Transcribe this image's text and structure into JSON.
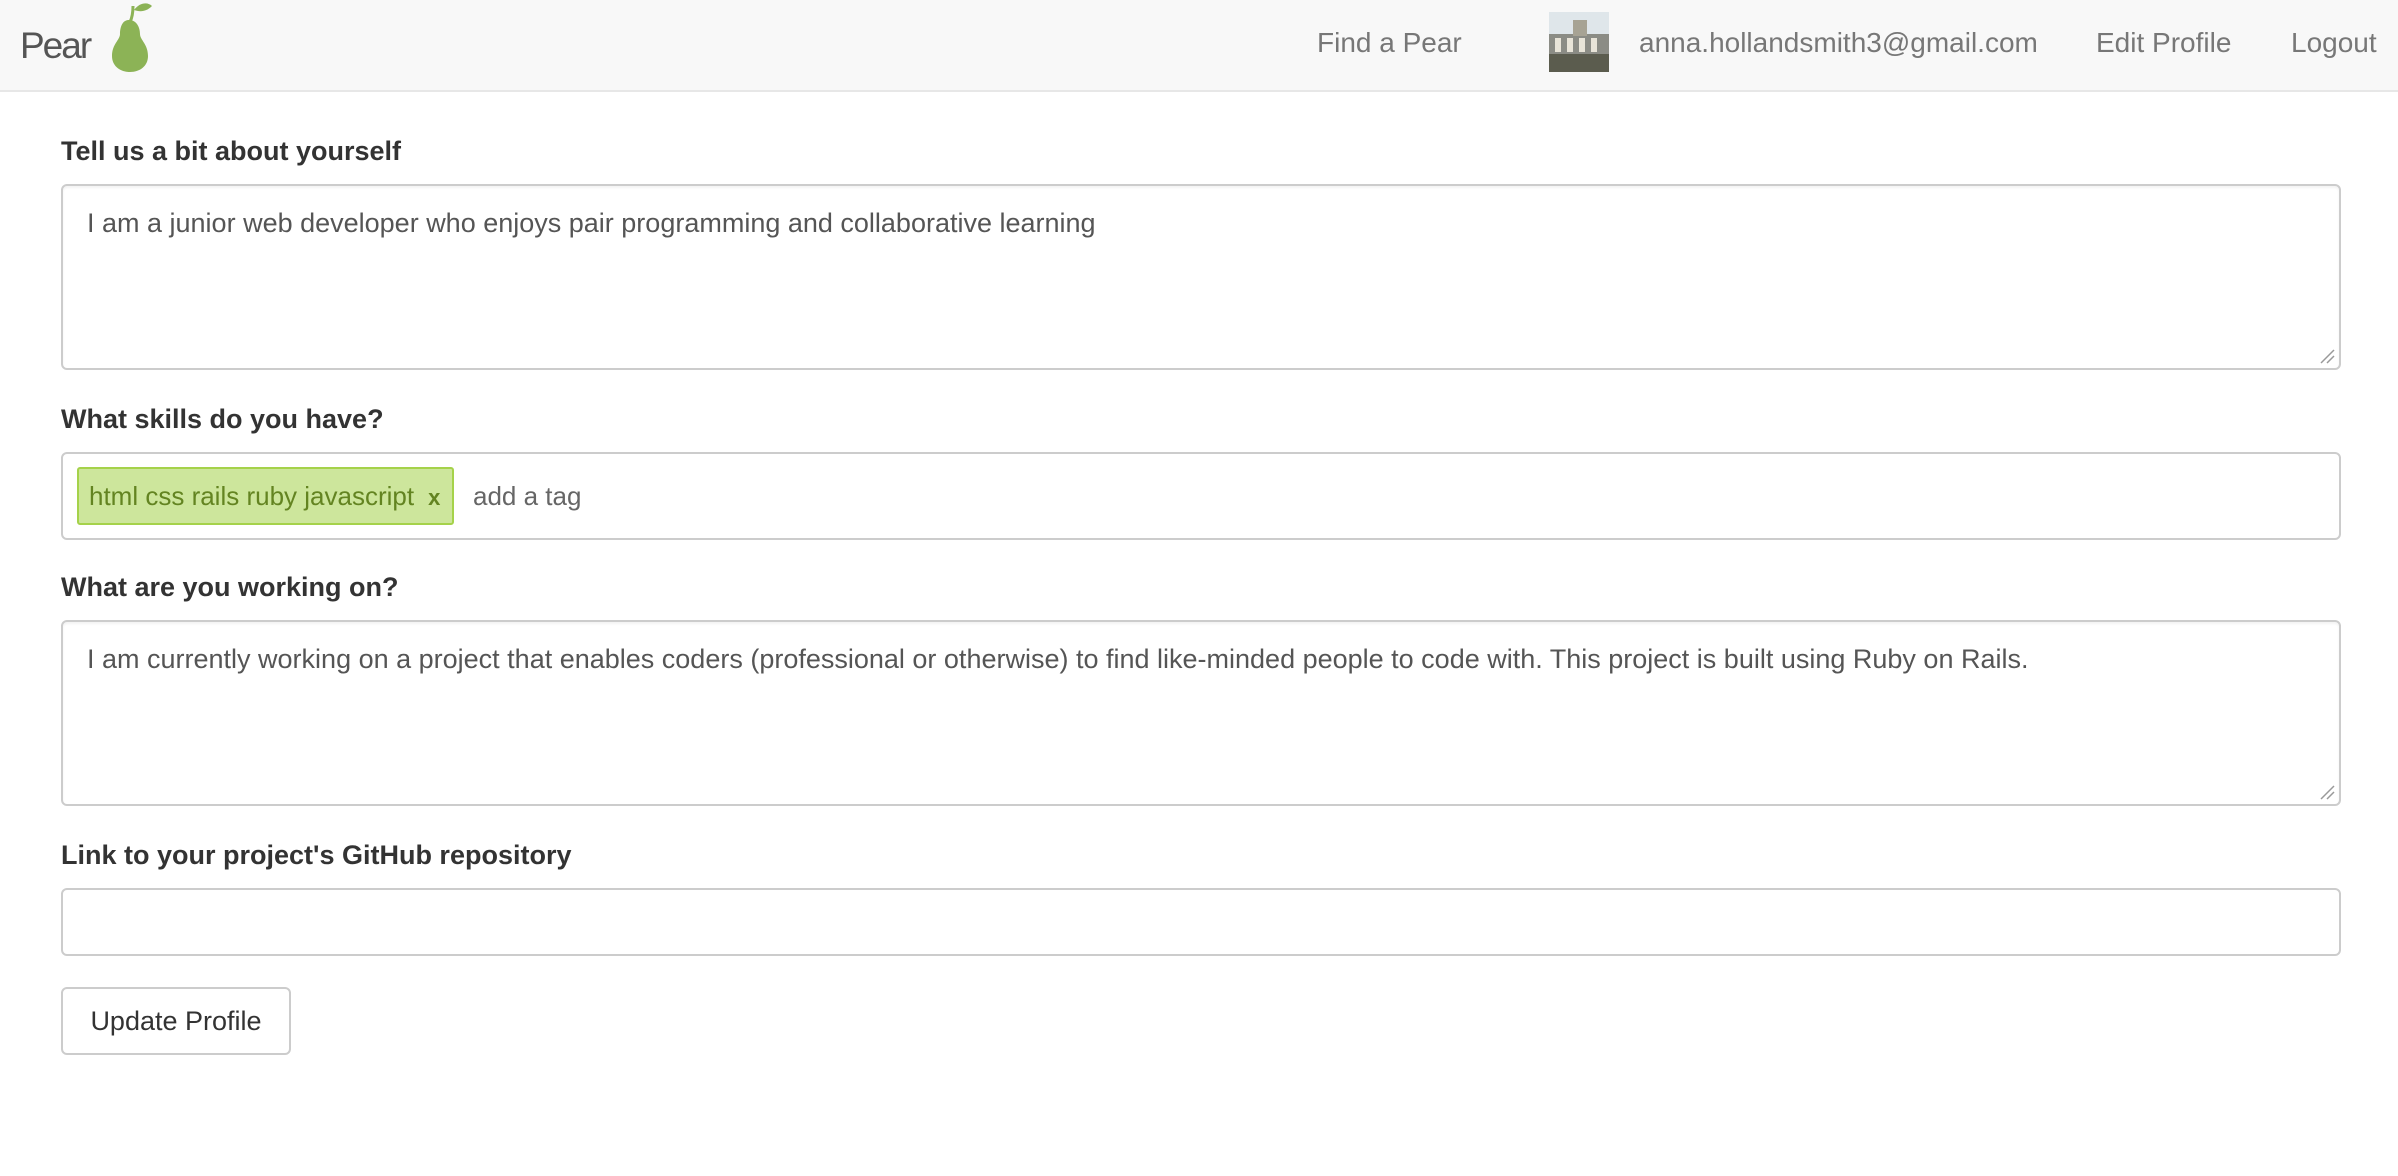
{
  "nav": {
    "brand": "Pear",
    "links": {
      "find": "Find a Pear",
      "email": "anna.hollandsmith3@gmail.com",
      "edit": "Edit Profile",
      "logout": "Logout"
    }
  },
  "form": {
    "about": {
      "label": "Tell us a bit about yourself",
      "value": "I am a junior web developer who enjoys pair programming and collaborative learning"
    },
    "skills": {
      "label": "What skills do you have?",
      "tags": [
        "html css rails ruby javascript"
      ],
      "remove_symbol": "x",
      "placeholder": "add a tag"
    },
    "working_on": {
      "label": "What are you working on?",
      "value": "I am currently working on a project that enables coders (professional or otherwise) to find like-minded people to code with. This project is built using Ruby on Rails."
    },
    "github": {
      "label": "Link to your project's GitHub repository",
      "value": ""
    },
    "submit_label": "Update Profile"
  },
  "colors": {
    "brand_pear": "#8cb356",
    "tag_bg": "#cde69c",
    "tag_border": "#a5d24a",
    "tag_text": "#638421"
  }
}
